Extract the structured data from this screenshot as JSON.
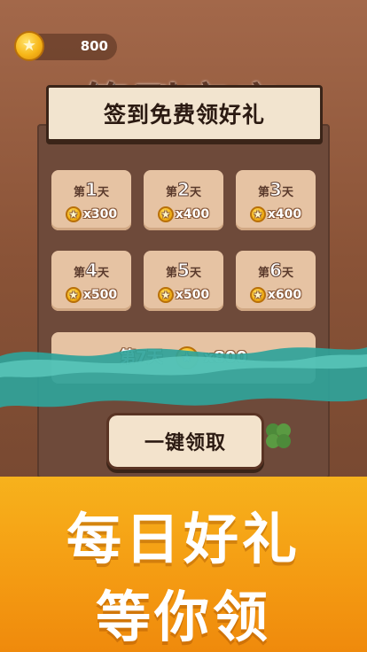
{
  "header": {
    "coin_balance": "800"
  },
  "background_title": "签到商店",
  "banner": {
    "title": "签到免费领好礼"
  },
  "days": [
    {
      "prefix": "第",
      "num": "1",
      "suffix": "天",
      "reward": "x300"
    },
    {
      "prefix": "第",
      "num": "2",
      "suffix": "天",
      "reward": "x400"
    },
    {
      "prefix": "第",
      "num": "3",
      "suffix": "天",
      "reward": "x400"
    },
    {
      "prefix": "第",
      "num": "4",
      "suffix": "天",
      "reward": "x500"
    },
    {
      "prefix": "第",
      "num": "5",
      "suffix": "天",
      "reward": "x500"
    },
    {
      "prefix": "第",
      "num": "6",
      "suffix": "天",
      "reward": "x600"
    },
    {
      "prefix": "第",
      "num": "7",
      "suffix": "天",
      "reward": "x800"
    }
  ],
  "claim_button": {
    "label": "一键领取"
  },
  "promo": {
    "line1": "每日好礼",
    "line2": "等你领"
  },
  "colors": {
    "panel": "#6e4a3a",
    "card": "#e6c3a3",
    "promo_orange": "#f49a12",
    "wave_teal": "#2fa39a"
  },
  "icons": {
    "coin": "coin-star-icon",
    "clover": "clover-icon"
  }
}
